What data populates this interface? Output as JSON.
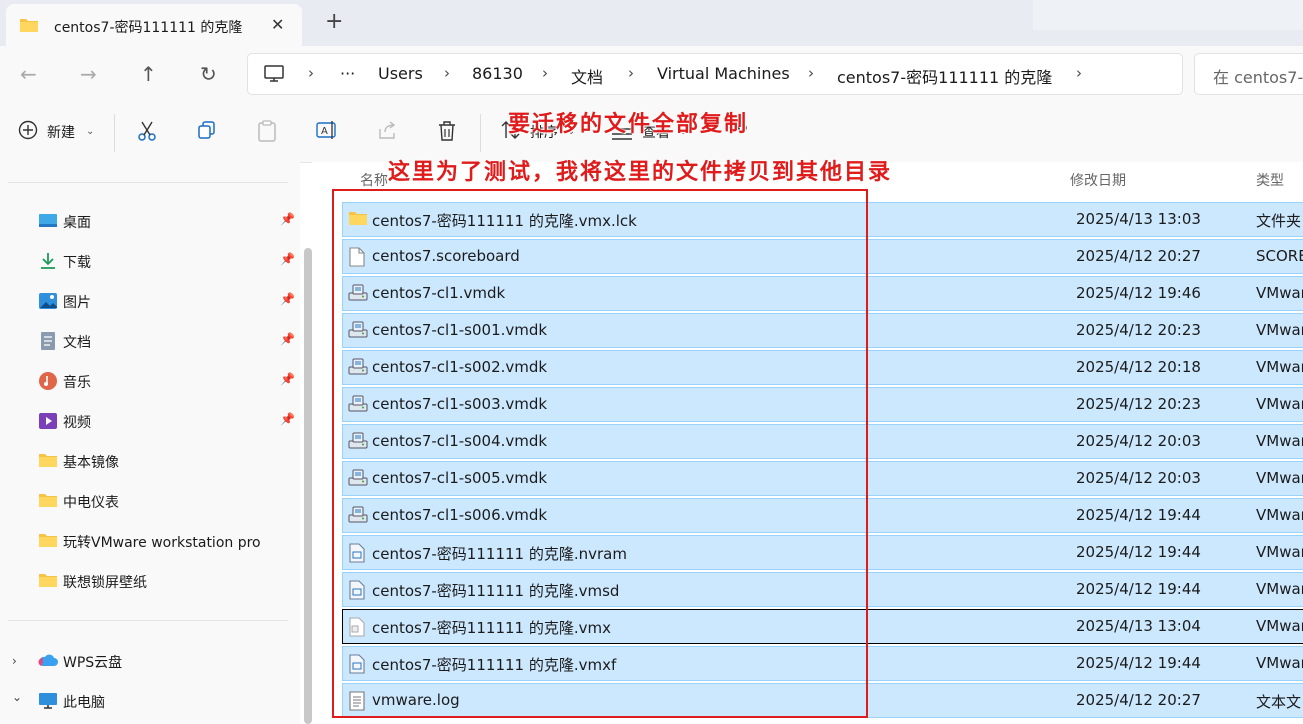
{
  "tab": {
    "title": "centos7-密码111111 的克隆",
    "close": "✕",
    "new_tab": "+"
  },
  "nav": {
    "back": "←",
    "forward": "→",
    "up": "↑",
    "refresh": "↻"
  },
  "breadcrumb": {
    "more": "···",
    "items": [
      "Users",
      "86130",
      "文档",
      "Virtual Machines",
      "centos7-密码111111 的克隆"
    ]
  },
  "search": {
    "placeholder": "在 centos7-"
  },
  "toolbar": {
    "new_label": "新建",
    "sort_label": "排序",
    "view_label": "查看",
    "more_label": "···"
  },
  "sidebar": {
    "items": [
      {
        "label": "桌面",
        "icon": "desktop-icon",
        "pinned": true
      },
      {
        "label": "下载",
        "icon": "download-icon",
        "pinned": true
      },
      {
        "label": "图片",
        "icon": "pictures-icon",
        "pinned": true
      },
      {
        "label": "文档",
        "icon": "documents-icon",
        "pinned": true
      },
      {
        "label": "音乐",
        "icon": "music-icon",
        "pinned": true
      },
      {
        "label": "视频",
        "icon": "videos-icon",
        "pinned": true
      },
      {
        "label": "基本镜像",
        "icon": "folder-icon",
        "pinned": false
      },
      {
        "label": "中电仪表",
        "icon": "folder-icon",
        "pinned": false
      },
      {
        "label": "玩转VMware workstation pro",
        "icon": "folder-icon",
        "pinned": false
      },
      {
        "label": "联想锁屏壁纸",
        "icon": "folder-icon",
        "pinned": false
      }
    ],
    "roots": [
      {
        "label": "WPS云盘",
        "icon": "wps-cloud-icon",
        "expander": "›"
      },
      {
        "label": "此电脑",
        "icon": "this-pc-icon",
        "expander": "⌄"
      }
    ]
  },
  "columns": {
    "name": "名称",
    "date": "修改日期",
    "type": "类型"
  },
  "files": [
    {
      "name": "centos7-密码111111 的克隆.vmx.lck",
      "date": "2025/4/13 13:03",
      "type": "文件夹",
      "icon": "folder-icon"
    },
    {
      "name": "centos7.scoreboard",
      "date": "2025/4/12 20:27",
      "type": "SCORE",
      "icon": "file-icon"
    },
    {
      "name": "centos7-cl1.vmdk",
      "date": "2025/4/12 19:46",
      "type": "VMwar",
      "icon": "vmdk-icon"
    },
    {
      "name": "centos7-cl1-s001.vmdk",
      "date": "2025/4/12 20:23",
      "type": "VMwar",
      "icon": "vmdk-icon"
    },
    {
      "name": "centos7-cl1-s002.vmdk",
      "date": "2025/4/12 20:18",
      "type": "VMwar",
      "icon": "vmdk-icon"
    },
    {
      "name": "centos7-cl1-s003.vmdk",
      "date": "2025/4/12 20:23",
      "type": "VMwar",
      "icon": "vmdk-icon"
    },
    {
      "name": "centos7-cl1-s004.vmdk",
      "date": "2025/4/12 20:03",
      "type": "VMwar",
      "icon": "vmdk-icon"
    },
    {
      "name": "centos7-cl1-s005.vmdk",
      "date": "2025/4/12 20:03",
      "type": "VMwar",
      "icon": "vmdk-icon"
    },
    {
      "name": "centos7-cl1-s006.vmdk",
      "date": "2025/4/12 19:44",
      "type": "VMwar",
      "icon": "vmdk-icon"
    },
    {
      "name": "centos7-密码111111 的克隆.nvram",
      "date": "2025/4/12 19:44",
      "type": "VMwar",
      "icon": "vmware-file-icon"
    },
    {
      "name": "centos7-密码111111 的克隆.vmsd",
      "date": "2025/4/12 19:44",
      "type": "VMwar",
      "icon": "vmware-file-icon"
    },
    {
      "name": "centos7-密码111111 的克隆.vmx",
      "date": "2025/4/13 13:04",
      "type": "VMwar",
      "icon": "vmx-icon"
    },
    {
      "name": "centos7-密码111111 的克隆.vmxf",
      "date": "2025/4/12 19:44",
      "type": "VMwar",
      "icon": "vmware-file-icon"
    },
    {
      "name": "vmware.log",
      "date": "2025/4/12 20:27",
      "type": "文本文",
      "icon": "text-file-icon"
    }
  ],
  "annotations": {
    "line1": "要迁移的文件全部复制",
    "line2": "这里为了测试，我将这里的文件拷贝到其他目录"
  },
  "colors": {
    "selection": "#cce8ff",
    "selection_border": "#99d1ff",
    "annotation": "#e01b1b"
  }
}
